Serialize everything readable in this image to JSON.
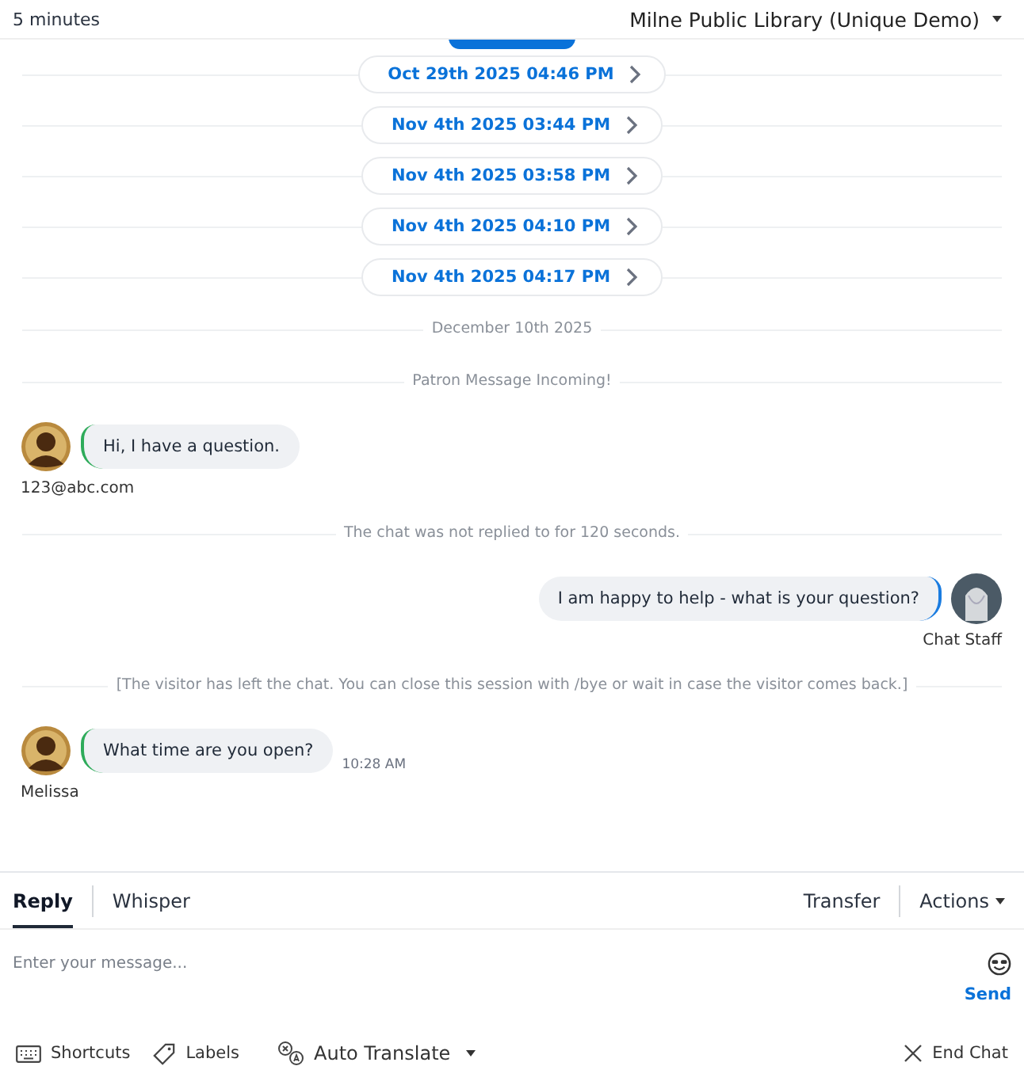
{
  "header": {
    "timer": "5 minutes",
    "library": "Milne Public Library (Unique Demo)"
  },
  "feed": [
    {
      "kind": "session",
      "text": "Oct 29th 2025 04:46 PM"
    },
    {
      "kind": "session",
      "text": "Nov 4th 2025 03:44 PM"
    },
    {
      "kind": "session",
      "text": "Nov 4th 2025 03:58 PM"
    },
    {
      "kind": "session",
      "text": "Nov 4th 2025 04:10 PM"
    },
    {
      "kind": "session",
      "text": "Nov 4th 2025 04:17 PM"
    },
    {
      "kind": "notice",
      "text": "December 10th 2025"
    },
    {
      "kind": "notice",
      "text": "Patron Message Incoming!"
    },
    {
      "kind": "patron",
      "text": "Hi, I have a question.",
      "sender": "123@abc.com"
    },
    {
      "kind": "notice",
      "text": "The chat was not replied to for 120 seconds."
    },
    {
      "kind": "staff",
      "text": "I am happy to help - what is your question?",
      "sender": "Chat Staff"
    },
    {
      "kind": "notice",
      "text": "[The visitor has left the chat. You can close this session with /bye or wait in case the visitor comes back.]"
    },
    {
      "kind": "patron",
      "text": "What time are you open?",
      "sender": "Melissa",
      "time": "10:28 AM"
    }
  ],
  "tabs": [
    {
      "label": "Reply",
      "selected": true
    },
    {
      "label": "Whisper",
      "selected": false
    }
  ],
  "actions": [
    "Transfer",
    "Actions"
  ],
  "composer": {
    "placeholder": "Enter your message...",
    "send": "Send"
  },
  "toolbar": {
    "shortcuts": "Shortcuts",
    "labels": "Labels",
    "translate": "Auto Translate",
    "end": "End Chat"
  }
}
